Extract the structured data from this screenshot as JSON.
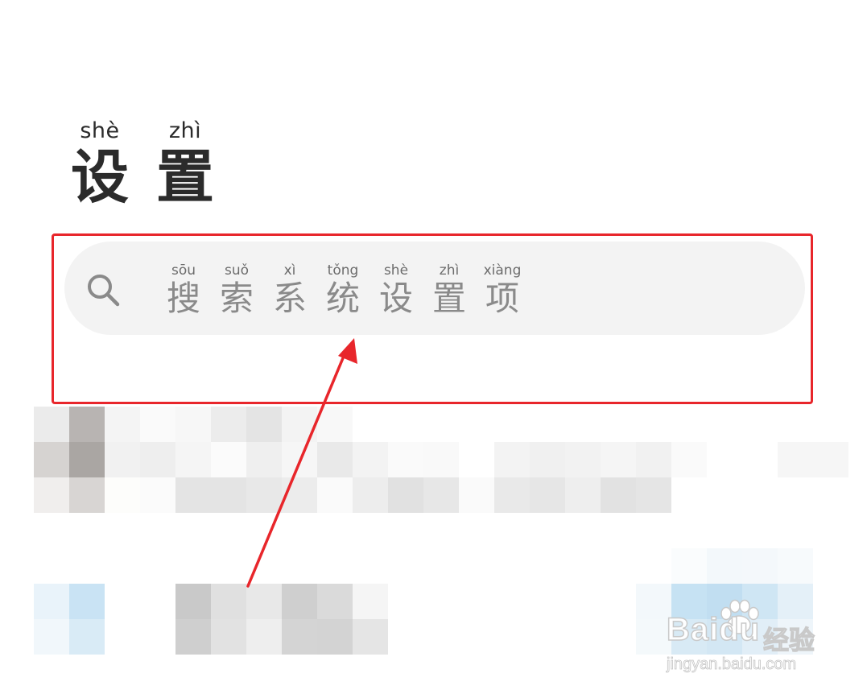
{
  "header": {
    "title_chars": [
      {
        "pinyin": "shè",
        "char": "设"
      },
      {
        "pinyin": "zhì",
        "char": "置"
      }
    ]
  },
  "search": {
    "icon": "search-icon",
    "placeholder_chars": [
      {
        "pinyin": "sōu",
        "char": "搜"
      },
      {
        "pinyin": "suǒ",
        "char": "索"
      },
      {
        "pinyin": "xì",
        "char": "系"
      },
      {
        "pinyin": "tǒng",
        "char": "统"
      },
      {
        "pinyin": "shè",
        "char": "设"
      },
      {
        "pinyin": "zhì",
        "char": "置"
      },
      {
        "pinyin": "xiàng",
        "char": "项"
      }
    ]
  },
  "annotation": {
    "highlight_color": "#e8262b",
    "arrow_color": "#e8262b"
  },
  "watermark": {
    "brand": "Baidu",
    "brand_cn": "经验",
    "url": "jingyan.baidu.com"
  }
}
